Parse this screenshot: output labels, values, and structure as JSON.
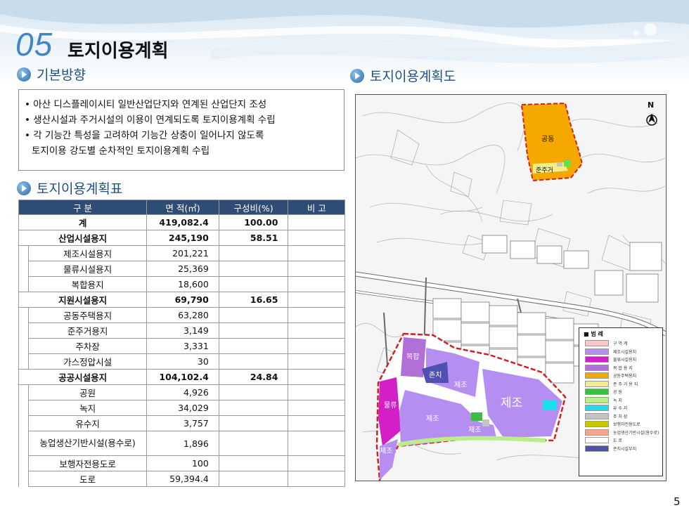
{
  "header": {
    "number": "05",
    "title": "토지이용계획"
  },
  "sections": {
    "basic": "기본방향",
    "table": "토지이용계획표",
    "map": "토지이용계획도"
  },
  "basic_points": [
    "• 아산 디스플레이시티 일반산업단지와 연계된 산업단지 조성",
    "• 생산시설과 주거시설의 이용이 연계되도록 토지이용계획 수립",
    "• 각 기능간 특성을 고려하여 기능간 상충이 일어나지 않도록",
    "  토지이용 강도별 순차적인 토지이용계획 수립"
  ],
  "table": {
    "headers": [
      "구 분",
      "면 적(㎡)",
      "구성비(%)",
      "비 고"
    ],
    "rows": [
      {
        "label": "계",
        "area": "419,082.4",
        "ratio": "100.00",
        "level": 0
      },
      {
        "label": "산업시설용지",
        "area": "245,190",
        "ratio": "58.51",
        "level": 0
      },
      {
        "label": "제조시설용지",
        "area": "201,221",
        "ratio": "",
        "level": 1
      },
      {
        "label": "물류시설용지",
        "area": "25,369",
        "ratio": "",
        "level": 1
      },
      {
        "label": "복합용지",
        "area": "18,600",
        "ratio": "",
        "level": 1
      },
      {
        "label": "지원시설용지",
        "area": "69,790",
        "ratio": "16.65",
        "level": 0
      },
      {
        "label": "공동주택용지",
        "area": "63,280",
        "ratio": "",
        "level": 1
      },
      {
        "label": "준주거용지",
        "area": "3,149",
        "ratio": "",
        "level": 1
      },
      {
        "label": "주차장",
        "area": "3,331",
        "ratio": "",
        "level": 1
      },
      {
        "label": "가스정압시설",
        "area": "30",
        "ratio": "",
        "level": 1
      },
      {
        "label": "공공시설용지",
        "area": "104,102.4",
        "ratio": "24.84",
        "level": 0
      },
      {
        "label": "공원",
        "area": "4,926",
        "ratio": "",
        "level": 1
      },
      {
        "label": "녹지",
        "area": "34,029",
        "ratio": "",
        "level": 1
      },
      {
        "label": "유수지",
        "area": "3,757",
        "ratio": "",
        "level": 1
      },
      {
        "label": "농업생산기반시설(용수로)",
        "area": "1,896",
        "ratio": "",
        "level": 1
      },
      {
        "label": "보행자전용도로",
        "area": "100",
        "ratio": "",
        "level": 1
      },
      {
        "label": "도로",
        "area": "59,394.4",
        "ratio": "",
        "level": 1
      }
    ]
  },
  "map": {
    "north": "N",
    "labels": {
      "housing": "공동",
      "semi_res": "준주거",
      "mixed": "복합",
      "logistics": "물류",
      "mfg": "제조",
      "mfg_big": "제조",
      "village": "존치"
    },
    "legend_title": "범 례",
    "legend": [
      {
        "name": "구 역 계",
        "color": "#f8c8c8"
      },
      {
        "name": "제조시설용지",
        "color": "#b48ef0"
      },
      {
        "name": "물류시설용지",
        "color": "#d21fc6"
      },
      {
        "name": "복 합 용 지",
        "color": "#b070d8"
      },
      {
        "name": "공동주택용지",
        "color": "#f5a800"
      },
      {
        "name": "준 주 거 용 지",
        "color": "#f2ef8a"
      },
      {
        "name": "공 원",
        "color": "#3cbf3c"
      },
      {
        "name": "녹 지",
        "color": "#b9ee8a"
      },
      {
        "name": "유 수 지",
        "color": "#18e0ea"
      },
      {
        "name": "주 차 장",
        "color": "#c4c4c4"
      },
      {
        "name": "보행자전용도로",
        "color": "#c8c800"
      },
      {
        "name": "농업생산기반시설(용수로)",
        "color": "#f4a888"
      },
      {
        "name": "도 로",
        "color": "#ffffff"
      },
      {
        "name": "존치시설부지",
        "color": "#5050b0"
      }
    ]
  },
  "page_number": "5"
}
